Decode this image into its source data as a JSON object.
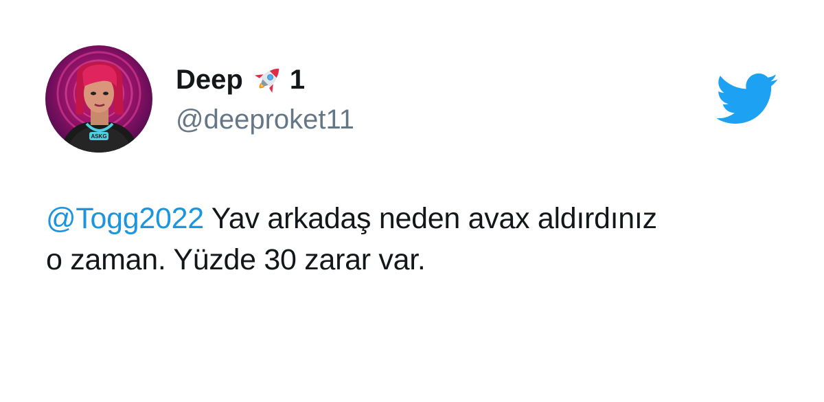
{
  "tweet": {
    "author": {
      "display_name": "Deep",
      "display_name_suffix": "1",
      "emoji_icon": "rocket-icon",
      "handle": "@deeproket11",
      "avatar_necklace_text": "ASKG"
    },
    "mention": "@Togg2022",
    "text_line1": " Yav arkadaş neden avax aldırdınız",
    "text_line2": "o zaman. Yüzde 30 zarar var."
  },
  "brand": {
    "icon": "twitter-bird-icon",
    "color": "#1da1f2"
  },
  "colors": {
    "mention": "#1b95e0",
    "handle": "#657786",
    "text": "#14171a"
  }
}
